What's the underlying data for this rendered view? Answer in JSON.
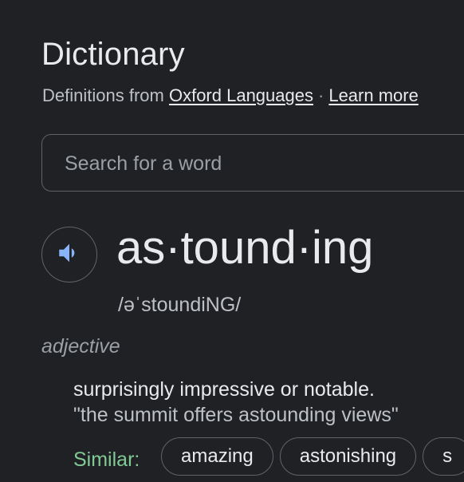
{
  "header": {
    "title": "Dictionary",
    "source_prefix": "Definitions from",
    "source_link": "Oxford Languages",
    "separator": "·",
    "learn_more": "Learn more"
  },
  "search": {
    "placeholder": "Search for a word",
    "value": ""
  },
  "entry": {
    "speaker_icon": "volume-up-icon",
    "headword": "as·tound·ing",
    "phonetic": "/əˈstoundiNG/",
    "part_of_speech": "adjective",
    "definition": "surprisingly impressive or notable.",
    "example": "\"the summit offers astounding views\"",
    "similar_label": "Similar:",
    "similar": [
      "amazing",
      "astonishing",
      "s"
    ]
  },
  "colors": {
    "background": "#202124",
    "accent_blue": "#8ab4f8",
    "similar_green": "#81c995",
    "border": "#5f6368"
  }
}
